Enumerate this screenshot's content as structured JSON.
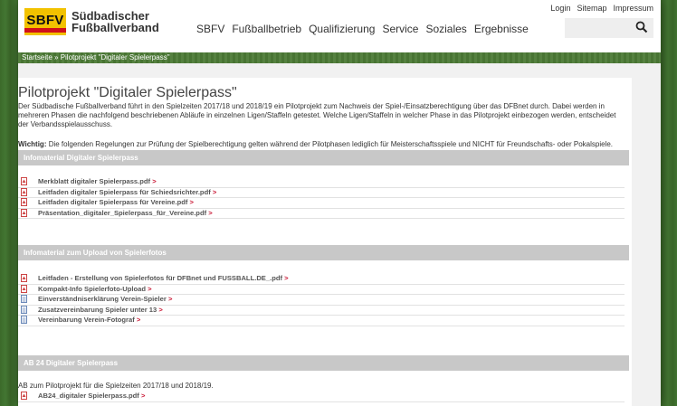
{
  "logo": {
    "abbr": "SBFV",
    "line1": "Südbadischer",
    "line2": "Fußballverband"
  },
  "metanav": [
    "Login",
    "Sitemap",
    "Impressum"
  ],
  "mainnav": [
    "SBFV",
    "Fußballbetrieb",
    "Qualifizierung",
    "Service",
    "Soziales",
    "Ergebnisse"
  ],
  "breadcrumb": "Startseite » Pilotprojekt \"Digitaler Spielerpass\"",
  "page": {
    "title": "Pilotprojekt \"Digitaler Spielerpass\"",
    "intro": "Der Südbadische Fußballverband führt in den Spielzeiten 2017/18 und 2018/19 ein Pilotprojekt zum Nachweis der Spiel-/Einsatzberechtigung über das DFBnet durch. Dabei werden in mehreren Phasen die nachfolgend beschriebenen Abläufe in einzelnen Ligen/Staffeln getestet. Welche Ligen/Staffeln in welcher Phase in das Pilotprojekt einbezogen werden, entscheidet der Verbandsspielausschuss.",
    "notice_label": "Wichtig:",
    "notice_text": " Die folgenden Regelungen zur Prüfung der Spielberechtigung gelten während der Pilotphasen lediglich für Meisterschaftsspiele und NICHT für Freundschafts- oder Pokalspiele."
  },
  "sections": [
    {
      "title": "Infomaterial Digitaler Spielerpass",
      "files": [
        {
          "label": "Merkblatt digitaler Spielerpass.pdf",
          "icon": "pdf-icon"
        },
        {
          "label": "Leitfaden digitaler Spielerpass für Schiedsrichter.pdf",
          "icon": "pdf-icon"
        },
        {
          "label": "Leitfaden digitaler Spielerpass für Vereine.pdf",
          "icon": "pdf-icon"
        },
        {
          "label": "Präsentation_digitaler_Spielerpass_für_Vereine.pdf",
          "icon": "pdf-icon"
        }
      ]
    },
    {
      "title": "Infomaterial zum Upload von Spielerfotos",
      "files": [
        {
          "label": "Leitfaden - Erstellung von Spielerfotos für DFBnet und FUSSBALL.DE_.pdf",
          "icon": "pdf-icon"
        },
        {
          "label": "Kompakt-Info Spielerfoto-Upload",
          "icon": "pdf-icon"
        },
        {
          "label": "Einverständniserklärung Verein-Spieler",
          "icon": "doc-icon"
        },
        {
          "label": "Zusatzvereinbarung Spieler unter 13",
          "icon": "doc-icon"
        },
        {
          "label": "Vereinbarung Verein-Fotograf",
          "icon": "doc-icon"
        }
      ]
    },
    {
      "title": "AB 24 Digitaler Spielerpass",
      "note": "AB zum Pilotprojekt für die Spielzeiten 2017/18 und 2018/19.",
      "files": [
        {
          "label": "AB24_digitaler Spielerpass.pdf",
          "icon": "pdf-icon"
        }
      ]
    }
  ],
  "link_arrow": ">",
  "colors": {
    "brand_yellow": "#f2c200",
    "brand_red": "#d0101a",
    "link_arrow": "#c8102e",
    "section_bar": "#c8c8c8"
  }
}
